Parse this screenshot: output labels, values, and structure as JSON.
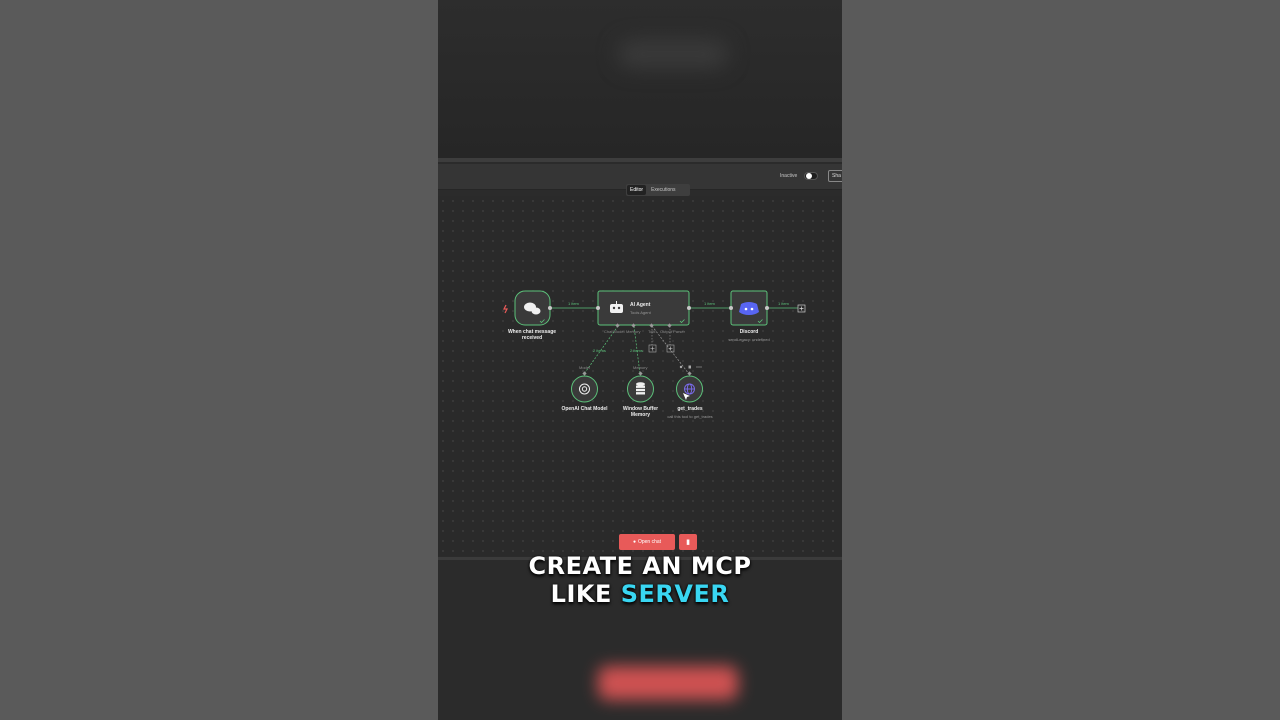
{
  "header": {
    "inactive_label": "Inactive",
    "share_label": "Sha"
  },
  "tabs": [
    {
      "label": "Editor",
      "active": true
    },
    {
      "label": "Executions",
      "active": false
    }
  ],
  "nodes": {
    "trigger": {
      "title": "When chat message received",
      "icon": "chat-bubbles-icon"
    },
    "agent": {
      "title": "AI Agent",
      "subtitle": "Tools Agent",
      "icon": "robot-icon"
    },
    "discord": {
      "title": "Discord",
      "subtitle": "sendLegacy: undefined",
      "icon": "discord-icon"
    },
    "model": {
      "title": "OpenAI Chat Model",
      "port": "Model",
      "icon": "openai-icon"
    },
    "memory": {
      "title": "Window Buffer Memory",
      "port": "Memory",
      "icon": "database-icon"
    },
    "tool": {
      "title": "get_trades",
      "subtitle": "call this tool to get_trades",
      "icon": "globe-icon"
    }
  },
  "agent_ports": [
    "Chat Model",
    "Memory",
    "Tool",
    "Output Parser"
  ],
  "connections": {
    "trigger_to_agent": "1 item",
    "agent_to_discord": "1 item",
    "discord_out": "1 item",
    "model_to_agent": "2 items",
    "memory_to_agent": "2 items"
  },
  "footer": {
    "open_chat_label": "Open chat",
    "trash_icon": "trash-icon"
  },
  "caption": {
    "line1": "CREATE AN MCP",
    "line2_prefix": "LIKE",
    "line2_highlight": "SERVER"
  },
  "colors": {
    "accent_green": "#5cc27a",
    "danger_red": "#e85a59",
    "caption_highlight": "#39d6f2",
    "discord_purple": "#5865f2"
  }
}
